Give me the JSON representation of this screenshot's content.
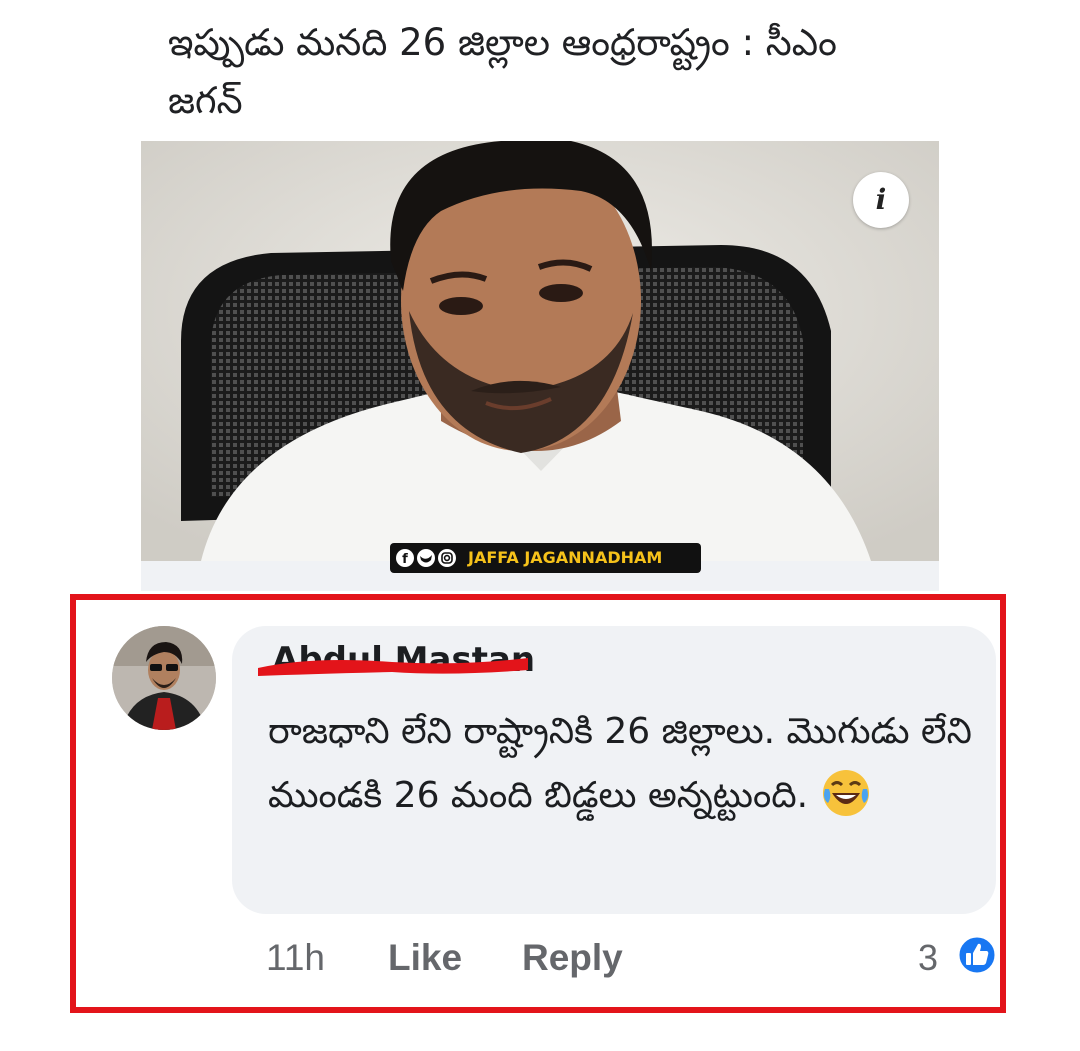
{
  "post": {
    "headline": "ఇప్పుడు మనది 26 జిల్లాల ఆంధ్రరాష్ట్రం : సీఎం జగన్",
    "info_label": "i",
    "watermark_text": "JAFFA JAGANNADHAM"
  },
  "comment": {
    "author": "Abdul Mastan",
    "text": "రాజధాని లేని రాష్ట్రానికి 26 జిల్లాలు. మొగుడు లేని ముండకి 26 మంది బిడ్డలు అన్నట్టుంది.",
    "emoji": "face-with-tears-of-joy",
    "time": "11h",
    "like_label": "Like",
    "reply_label": "Reply",
    "reaction_count": "3"
  },
  "colors": {
    "highlight_border": "#e3141a",
    "bubble": "#f0f2f5",
    "action_text": "#65676b",
    "like_blue": "#1877f2",
    "watermark_accent": "#f6c21a"
  }
}
